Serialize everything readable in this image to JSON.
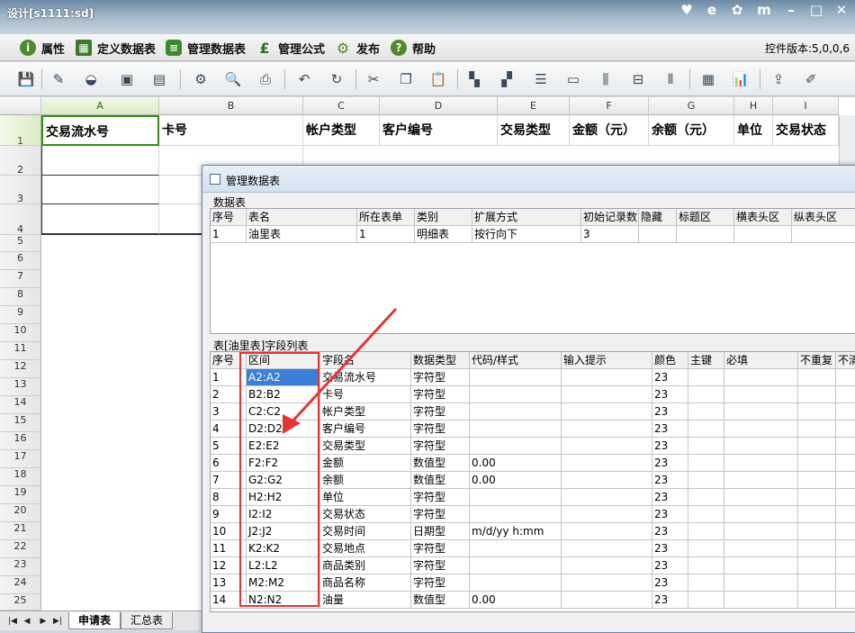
{
  "window": {
    "title": "设计[s1111:sd]"
  },
  "menubar": {
    "items": [
      {
        "label": "属性",
        "icon": "info-icon",
        "color": "#4f8a2e"
      },
      {
        "label": "定义数据表",
        "icon": "table-define-icon",
        "color": "#3f7a2a"
      },
      {
        "label": "管理数据表",
        "icon": "database-icon",
        "color": "#3c8a2a"
      },
      {
        "label": "管理公式",
        "icon": "pound-formula-icon",
        "color": "#2f6f28"
      },
      {
        "label": "发布",
        "icon": "gear-publish-icon",
        "color": "#4f8a2e"
      },
      {
        "label": "帮助",
        "icon": "help-icon",
        "color": "#4f8a2e"
      }
    ],
    "version": "控件版本:5,0,0,6"
  },
  "toolbar": {
    "icons": [
      "save-icon",
      "brush-icon",
      "paint-bucket-icon",
      "image-icon",
      "image-insert-icon",
      "settings-page-icon",
      "preview-icon",
      "print-icon",
      "undo-icon",
      "redo-icon",
      "cut-icon",
      "copy-icon",
      "paste-icon",
      "merge-cells-icon",
      "split-cells-icon",
      "insert-row-icon",
      "delete-row-icon",
      "insert-column-icon",
      "delete-column-icon",
      "align-icon",
      "table-grid-icon",
      "bar-chart-icon",
      "export-icon",
      "clear-icon"
    ]
  },
  "sheet": {
    "columns": [
      "A",
      "B",
      "C",
      "D",
      "E",
      "F",
      "G",
      "H",
      "I"
    ],
    "rows": [
      "1",
      "2",
      "3",
      "4",
      "5",
      "6",
      "7",
      "8",
      "9",
      "10",
      "11",
      "12",
      "13",
      "14",
      "15",
      "16",
      "17",
      "18",
      "19",
      "20",
      "21",
      "22",
      "23",
      "24",
      "25"
    ],
    "header_cells": [
      "交易流水号",
      "卡号",
      "帐户类型",
      "客户编号",
      "交易类型",
      "金额（元）",
      "余额（元）",
      "单位",
      "交易状态"
    ]
  },
  "sheet_tabs": {
    "tabs": [
      "申请表",
      "汇总表"
    ]
  },
  "dialog": {
    "title": "管理数据表",
    "datatable_group": "数据表",
    "datatable_headers": [
      "序号",
      "表名",
      "所在表单",
      "类别",
      "扩展方式",
      "初始记录数",
      "隐藏",
      "标题区",
      "横表头区",
      "纵表头区"
    ],
    "datatable_rows": [
      [
        "1",
        "油里表",
        "1",
        "明细表",
        "按行向下",
        "3",
        "",
        "",
        "",
        ""
      ]
    ],
    "fields_group": "表[油里表]字段列表",
    "field_headers": [
      "序号",
      "区间",
      "字段名",
      "数据类型",
      "代码/样式",
      "输入提示",
      "颜色",
      "主键",
      "必填",
      "不重复",
      "不清"
    ],
    "field_rows": [
      [
        "1",
        "A2:A2",
        "交易流水号",
        "字符型",
        "",
        "",
        "23"
      ],
      [
        "2",
        "B2:B2",
        "卡号",
        "字符型",
        "",
        "",
        "23"
      ],
      [
        "3",
        "C2:C2",
        "帐户类型",
        "字符型",
        "",
        "",
        "23"
      ],
      [
        "4",
        "D2:D2",
        "客户编号",
        "字符型",
        "",
        "",
        "23"
      ],
      [
        "5",
        "E2:E2",
        "交易类型",
        "字符型",
        "",
        "",
        "23"
      ],
      [
        "6",
        "F2:F2",
        "金额",
        "数值型",
        "0.00",
        "",
        "23"
      ],
      [
        "7",
        "G2:G2",
        "余额",
        "数值型",
        "0.00",
        "",
        "23"
      ],
      [
        "8",
        "H2:H2",
        "单位",
        "字符型",
        "",
        "",
        "23"
      ],
      [
        "9",
        "I2:I2",
        "交易状态",
        "字符型",
        "",
        "",
        "23"
      ],
      [
        "10",
        "J2:J2",
        "交易时间",
        "日期型",
        "m/d/yy h:mm",
        "",
        "23"
      ],
      [
        "11",
        "K2:K2",
        "交易地点",
        "字符型",
        "",
        "",
        "23"
      ],
      [
        "12",
        "L2:L2",
        "商品类别",
        "字符型",
        "",
        "",
        "23"
      ],
      [
        "13",
        "M2:M2",
        "商品名称",
        "字符型",
        "",
        "",
        "23"
      ],
      [
        "14",
        "N2:N2",
        "油量",
        "数值型",
        "0.00",
        "",
        "23"
      ]
    ]
  },
  "annotation": {
    "color": "#e43535"
  }
}
